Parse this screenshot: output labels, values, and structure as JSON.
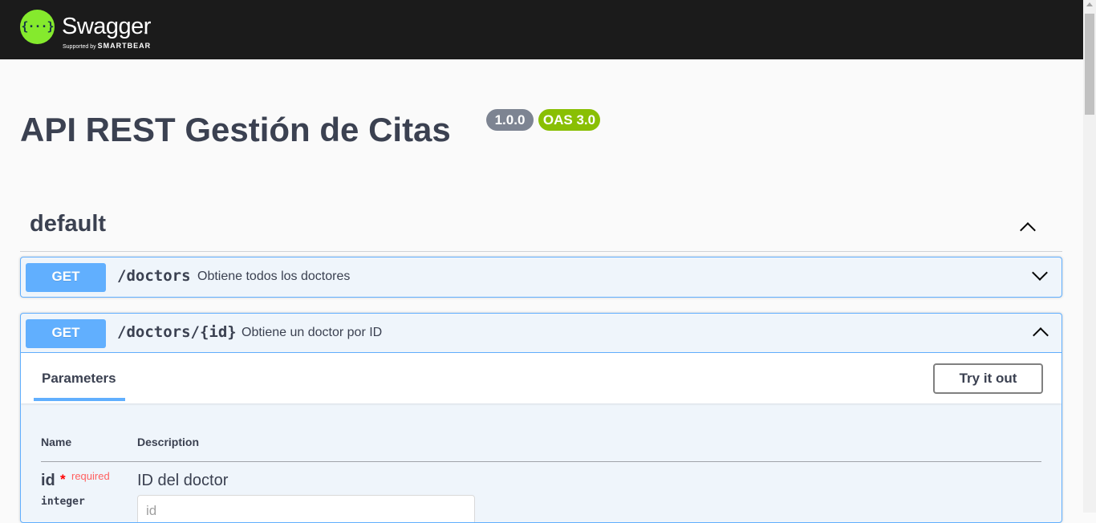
{
  "brand": {
    "name": "Swagger",
    "tm": "™",
    "icon": "swagger-logo-icon",
    "glyph": "{···}",
    "supported_by": "Supported by",
    "company": "SMARTBEAR"
  },
  "api": {
    "title": "API REST Gestión de Citas",
    "version": "1.0.0",
    "spec": "OAS 3.0"
  },
  "tag": {
    "name": "default",
    "icon": "chevron-up-icon"
  },
  "operations": [
    {
      "method": "GET",
      "path": "/doctors",
      "summary": "Obtiene todos los doctores",
      "icon": "chevron-down-icon",
      "expanded": false
    },
    {
      "method": "GET",
      "path": "/doctors/{id}",
      "summary": "Obtiene un doctor por ID",
      "icon": "chevron-up-icon",
      "expanded": true,
      "tab_label": "Parameters",
      "try_label": "Try it out",
      "columns": {
        "name": "Name",
        "description": "Description"
      },
      "parameters": [
        {
          "name": "id",
          "required_mark": "*",
          "required_label": "required",
          "type": "integer",
          "description": "ID del doctor",
          "placeholder": "id",
          "value": ""
        }
      ]
    }
  ],
  "colors": {
    "topbar": "#1b1b1b",
    "brand_green": "#85ea2d",
    "get_blue": "#61affe",
    "version_badge": "#7d8492",
    "oas_badge": "#89bf04"
  }
}
